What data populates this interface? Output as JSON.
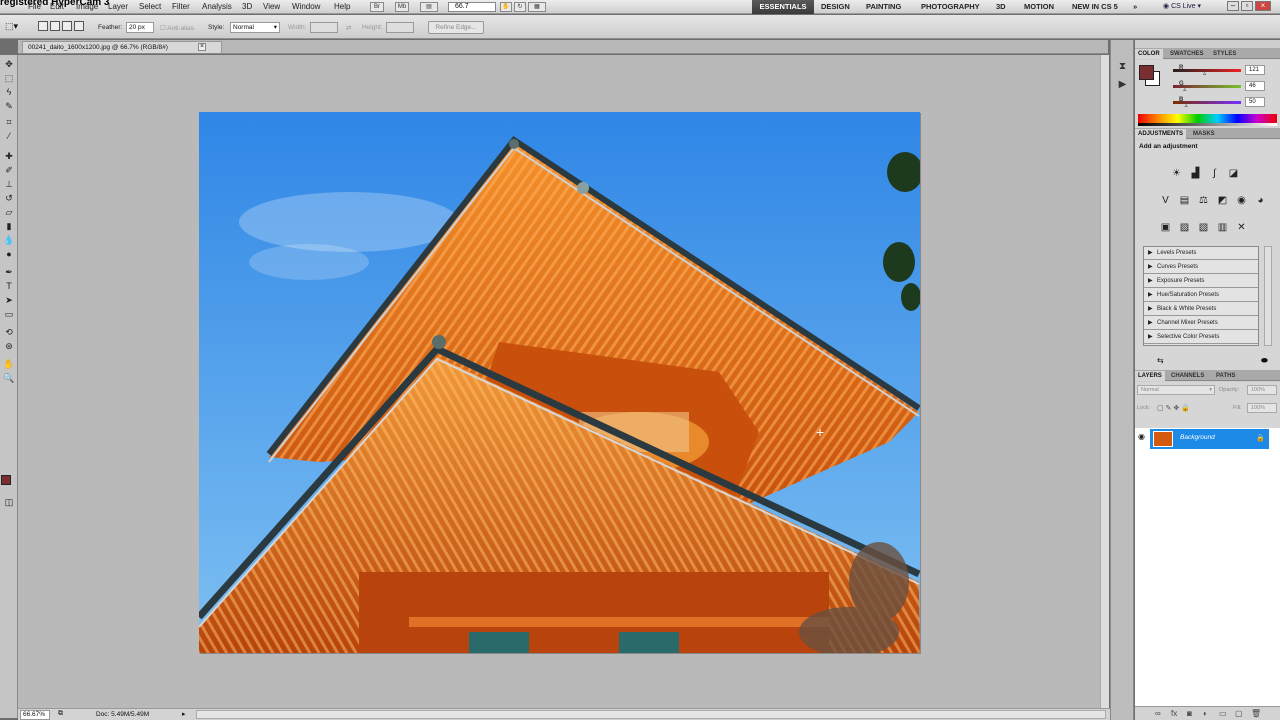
{
  "overlay": {
    "watermark": "registered HyperCam 3"
  },
  "menubar": {
    "items": [
      "File",
      "Edit",
      "Image",
      "Layer",
      "Select",
      "Filter",
      "Analysis",
      "3D",
      "View",
      "Window",
      "Help"
    ],
    "zoom": "66.7",
    "workspaces": [
      "ESSENTIALS",
      "DESIGN",
      "PAINTING",
      "PHOTOGRAPHY",
      "3D",
      "MOTION",
      "NEW IN CS 5"
    ],
    "active_workspace": "ESSENTIALS",
    "more": "»",
    "cs_live": "CS Live"
  },
  "options": {
    "feather_label": "Feather:",
    "feather_value": "20 px",
    "antialias_label": "Anti-alias",
    "style_label": "Style:",
    "style_value": "Normal",
    "width_label": "Width:",
    "height_label": "Height:",
    "refine_edge": "Refine Edge..."
  },
  "document": {
    "tab_title": "00241_daito_1600x1200.jpg @ 66.7% (RGB/8#)",
    "close": "×",
    "zoom": "66.67%",
    "doc_info": "Doc: 5.49M/5.49M"
  },
  "panels": {
    "color": {
      "tabs": [
        "COLOR",
        "SWATCHES",
        "STYLES"
      ],
      "channels": [
        {
          "label": "R",
          "value": "121",
          "fraction": 0.47
        },
        {
          "label": "G",
          "value": "46",
          "fraction": 0.18
        },
        {
          "label": "B",
          "value": "50",
          "fraction": 0.2
        }
      ],
      "foreground": "#7b2e32"
    },
    "adjustments": {
      "tabs": [
        "ADJUSTMENTS",
        "MASKS"
      ],
      "title": "Add an adjustment",
      "presets": [
        "Levels Presets",
        "Curves Presets",
        "Exposure Presets",
        "Hue/Saturation Presets",
        "Black & White Presets",
        "Channel Mixer Presets",
        "Selective Color Presets"
      ]
    },
    "layers": {
      "tabs": [
        "LAYERS",
        "CHANNELS",
        "PATHS"
      ],
      "blend_mode": "Normal",
      "opacity_label": "Opacity:",
      "opacity": "100%",
      "lock_label": "Lock:",
      "fill_label": "Fill:",
      "fill": "100%",
      "layer_name": "Background"
    }
  },
  "colors": {
    "accent": "#1e8ae8",
    "pagoda_orange": "#e0620f",
    "sky": "#3a8fe0"
  }
}
